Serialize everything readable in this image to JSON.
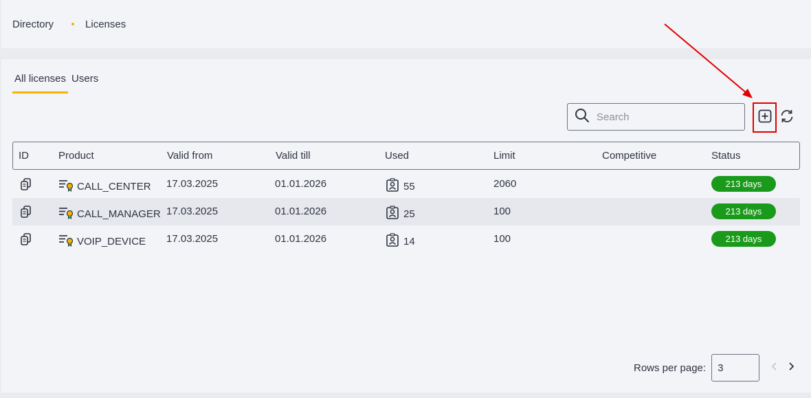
{
  "breadcrumb": {
    "items": [
      "Directory",
      "Licenses"
    ]
  },
  "tabs": [
    {
      "label": "All licenses",
      "active": true
    },
    {
      "label": "Users",
      "active": false
    }
  ],
  "search": {
    "placeholder": "Search",
    "value": ""
  },
  "toolbar": {
    "add_icon": "plus-square-icon",
    "refresh_icon": "refresh-icon"
  },
  "table": {
    "columns": [
      "ID",
      "Product",
      "Valid from",
      "Valid till",
      "Used",
      "Limit",
      "Competitive",
      "Status"
    ],
    "rows": [
      {
        "product": "CALL_CENTER",
        "valid_from": "17.03.2025",
        "valid_till": "01.01.2026",
        "used": "55",
        "limit": "2060",
        "competitive": "",
        "status": "213 days"
      },
      {
        "product": "CALL_MANAGER",
        "valid_from": "17.03.2025",
        "valid_till": "01.01.2026",
        "used": "25",
        "limit": "100",
        "competitive": "",
        "status": "213 days"
      },
      {
        "product": "VOIP_DEVICE",
        "valid_from": "17.03.2025",
        "valid_till": "01.01.2026",
        "used": "14",
        "limit": "100",
        "competitive": "",
        "status": "213 days"
      }
    ]
  },
  "pagination": {
    "rows_per_page_label": "Rows per page:",
    "rows_per_page_value": "3"
  },
  "colors": {
    "accent": "#f5b400",
    "status_green": "#1a9a1a",
    "annotation_red": "#e00000"
  }
}
